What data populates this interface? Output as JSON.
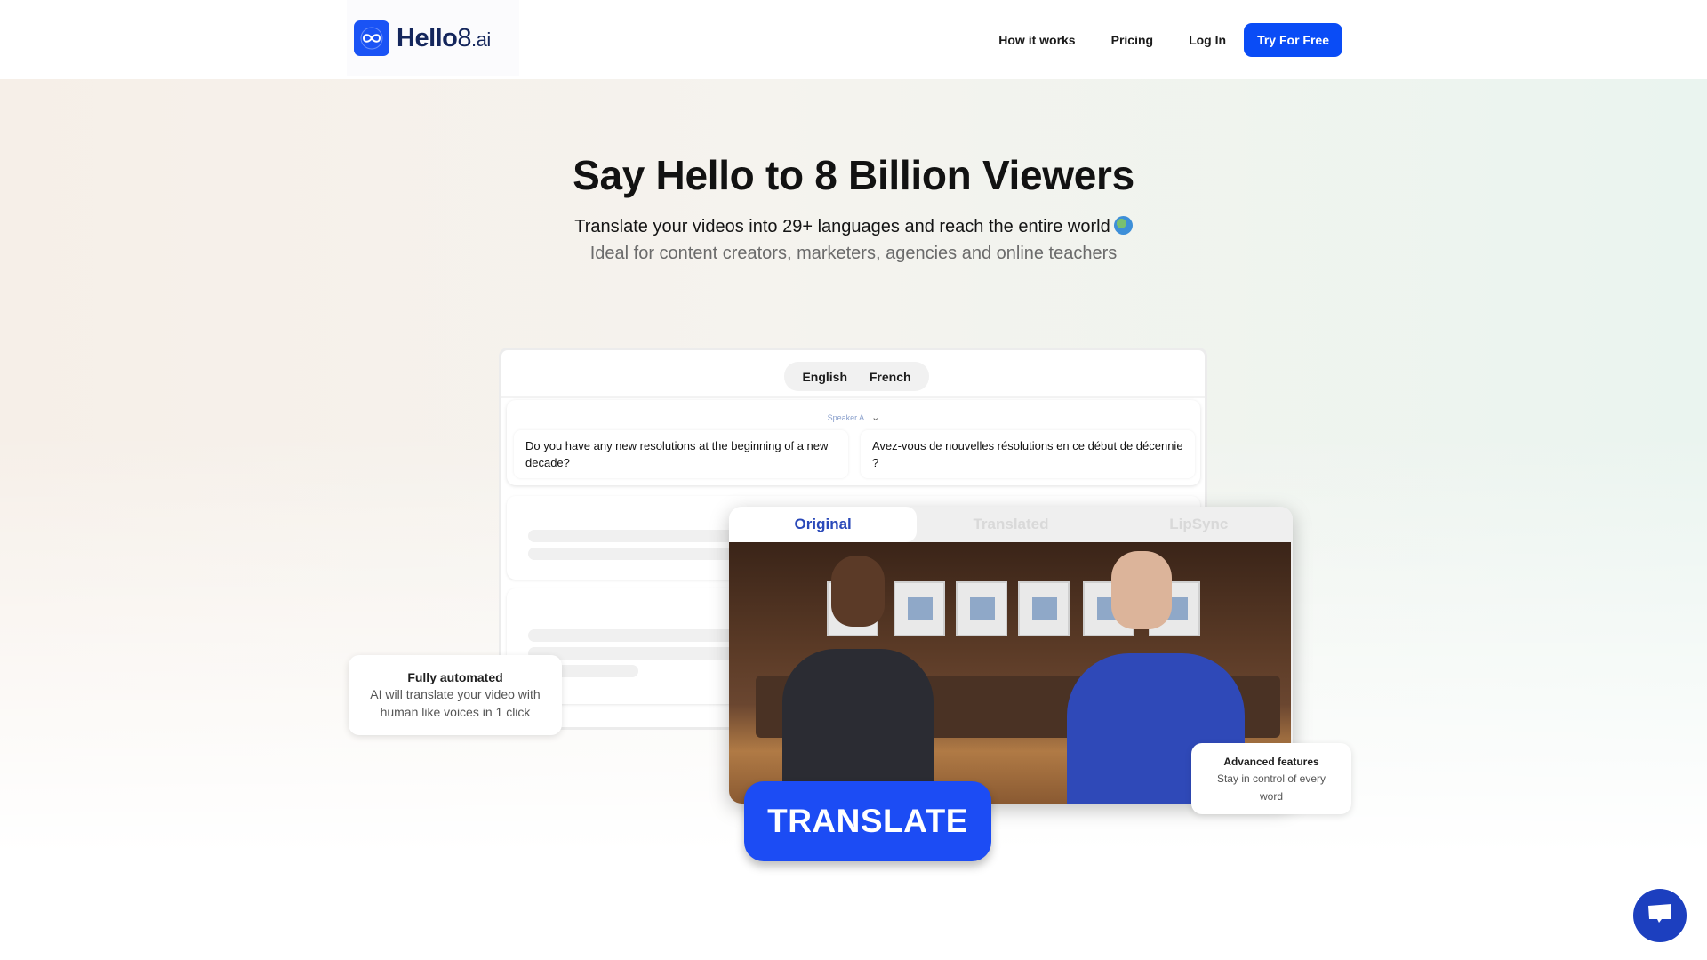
{
  "brand": {
    "name_bold": "Hello",
    "name_number": "8",
    "name_tld": ".ai",
    "accent_color": "#0a4cf6",
    "logo_icon": "infinity-globe-icon"
  },
  "nav": {
    "items": [
      {
        "label": "How it works"
      },
      {
        "label": "Pricing"
      },
      {
        "label": "Log In"
      }
    ],
    "cta_label": "Try For Free"
  },
  "hero": {
    "title": "Say Hello to 8 Billion Viewers",
    "subtitle": "Translate your videos into 29+ languages and reach the entire world",
    "subtitle_icon": "globe-emoji",
    "tagline": "Ideal for content creators, marketers, agencies and online teachers"
  },
  "editor": {
    "languages": [
      "English",
      "French"
    ],
    "segment": {
      "speaker": "Speaker A",
      "source_text": "Do you have any new resolutions at the beginning of a new decade?",
      "translated_text": "Avez-vous de nouvelles résolutions en ce début de décennie ?"
    }
  },
  "video": {
    "tabs": [
      {
        "label": "Original",
        "active": true
      },
      {
        "label": "Translated",
        "active": false
      },
      {
        "label": "LipSync",
        "active": false
      }
    ]
  },
  "translate_button": "TRANSLATE",
  "features": [
    {
      "title": "Fully automated",
      "description": "AI will translate your video with human like voices in 1 click"
    },
    {
      "title": "Advanced features",
      "description": "Stay in control of every word"
    }
  ],
  "chat_widget": {
    "icon": "chat-bubble-icon"
  }
}
